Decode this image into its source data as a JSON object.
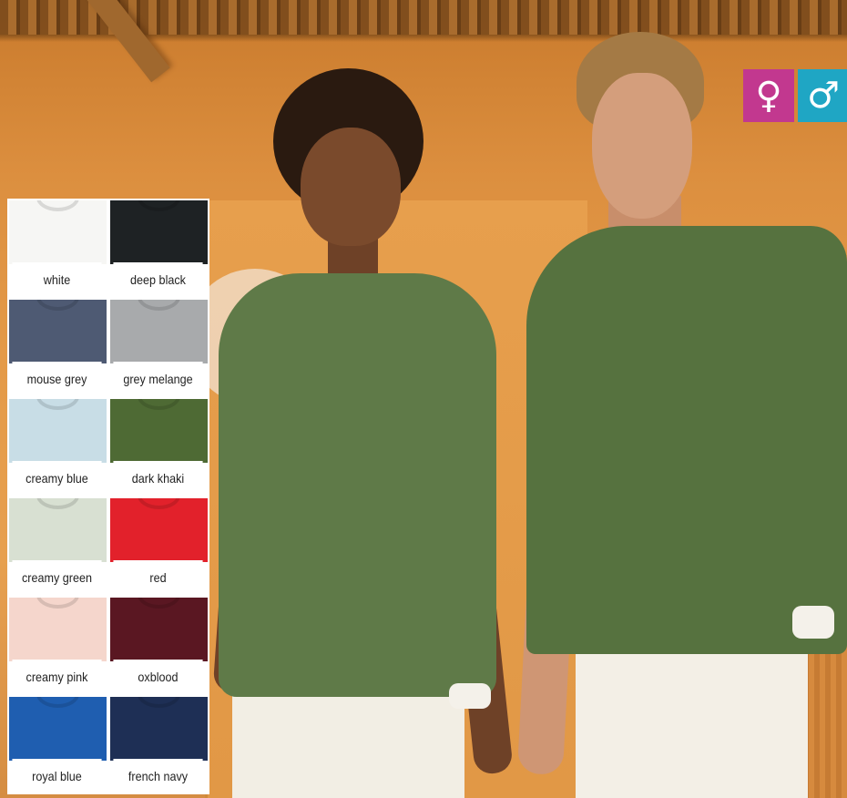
{
  "gender_badges": [
    {
      "symbol": "♀",
      "icon": "female-symbol-icon",
      "color": "#c2388f"
    },
    {
      "symbol": "♂",
      "icon": "male-symbol-icon",
      "color": "#1fa6c4"
    }
  ],
  "swatches": [
    {
      "label": "white",
      "color": "#f6f6f4"
    },
    {
      "label": "deep black",
      "color": "#1e2224"
    },
    {
      "label": "mouse grey",
      "color": "#4e5a73"
    },
    {
      "label": "grey melange",
      "color": "#a8aaac"
    },
    {
      "label": "creamy blue",
      "color": "#c8dde6"
    },
    {
      "label": "dark khaki",
      "color": "#4e6a34"
    },
    {
      "label": "creamy green",
      "color": "#d8e0d2"
    },
    {
      "label": "red",
      "color": "#e2212b"
    },
    {
      "label": "creamy pink",
      "color": "#f5d6cc"
    },
    {
      "label": "oxblood",
      "color": "#5a1722"
    },
    {
      "label": "royal blue",
      "color": "#1f5eb0"
    },
    {
      "label": "french navy",
      "color": "#1e2f55"
    }
  ]
}
